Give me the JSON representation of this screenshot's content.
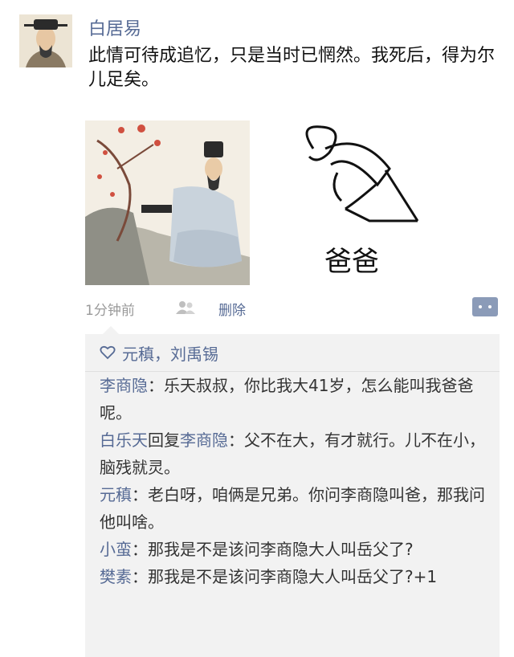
{
  "post": {
    "author": "白居易",
    "text": "此情可待成追忆，只是当时已惘然。我死后，得为尔儿足矣。",
    "image_caption": "爸爸",
    "time": "1分钟前",
    "delete_label": "删除"
  },
  "likes": "元稹，刘禹锡",
  "comments": [
    {
      "name": "李商隐",
      "sep": "：",
      "text": "乐天叔叔，你比我大41岁，怎么能叫我爸爸呢。"
    },
    {
      "name": "白乐天",
      "reply_label": "回复",
      "reply_to": "李商隐",
      "sep": "：",
      "text": "父不在大，有才就行。儿不在小，脑残就灵。"
    },
    {
      "name": "元稹",
      "sep": "：",
      "text": "老白呀，咱俩是兄弟。你问李商隐叫爸，那我问他叫啥。"
    },
    {
      "name": "小蛮",
      "sep": "：",
      "text": "那我是不是该问李商隐大人叫岳父了?"
    },
    {
      "name": "樊素",
      "sep": "：",
      "text": "那我是不是该问李商隐大人叫岳父了?+1"
    }
  ],
  "colors": {
    "link": "#576b95",
    "comment_bg": "#f2f2f2",
    "meta": "#9a9a9a"
  }
}
